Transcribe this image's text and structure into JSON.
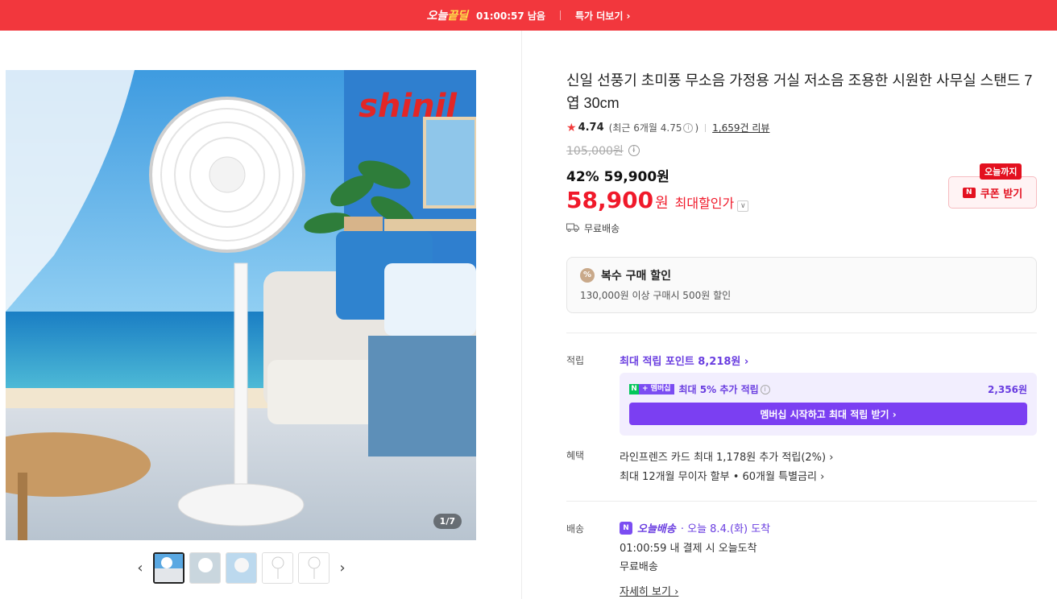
{
  "topbar": {
    "brand_a": "오늘",
    "brand_b": "끝딜",
    "timer": "01:00:57 남음",
    "more": "특가 더보기 ›"
  },
  "gallery": {
    "counter": "1/7",
    "logo_text": "shinil",
    "prev_icon": "‹",
    "next_icon": "›"
  },
  "product": {
    "title": "신일 선풍기 초미풍 무소음 가정용 거실 저소음 조용한 시원한 사무실 스탠드 7엽 30cm",
    "rating": "4.74",
    "rating_recent": "(최근 6개월 4.75",
    "rating_recent_end": ")",
    "reviews": "1,659건 리뷰",
    "original_price": "105,000원",
    "sale": "42% 59,900원",
    "final_price": "58,900",
    "won": "원",
    "final_label": "최대할인가",
    "shipping": "무료배송"
  },
  "coupon": {
    "tag": "오늘까지",
    "badge": "N",
    "label": "쿠폰 받기"
  },
  "multi": {
    "title": "복수 구매 할인",
    "desc": "130,000원 이상 구매시 500원 할인",
    "icon": "%"
  },
  "points": {
    "label": "적립",
    "link": "최대 적립 포인트 8,218원 ›",
    "member_badge_n": "N",
    "member_badge_plus": "+ 멤버십",
    "member_text": "최대 5% 추가 적립",
    "member_amount": "2,356원",
    "member_button": "멤버십 시작하고 최대 적립 받기 ›"
  },
  "benefit": {
    "label": "혜택",
    "line1": "라인프렌즈 카드 최대 1,178원 추가 적립(2%) ›",
    "line2": "최대 12개월 무이자 할부 • 60개월 특별금리 ›"
  },
  "delivery": {
    "label": "배송",
    "badge": "N",
    "name": "오늘배송",
    "eta": "· 오늘 8.4.(화) 도착",
    "cutoff": "01:00:59  내 결제 시 오늘도착",
    "fee": "무료배송",
    "details": "자세히 보기 ›"
  }
}
